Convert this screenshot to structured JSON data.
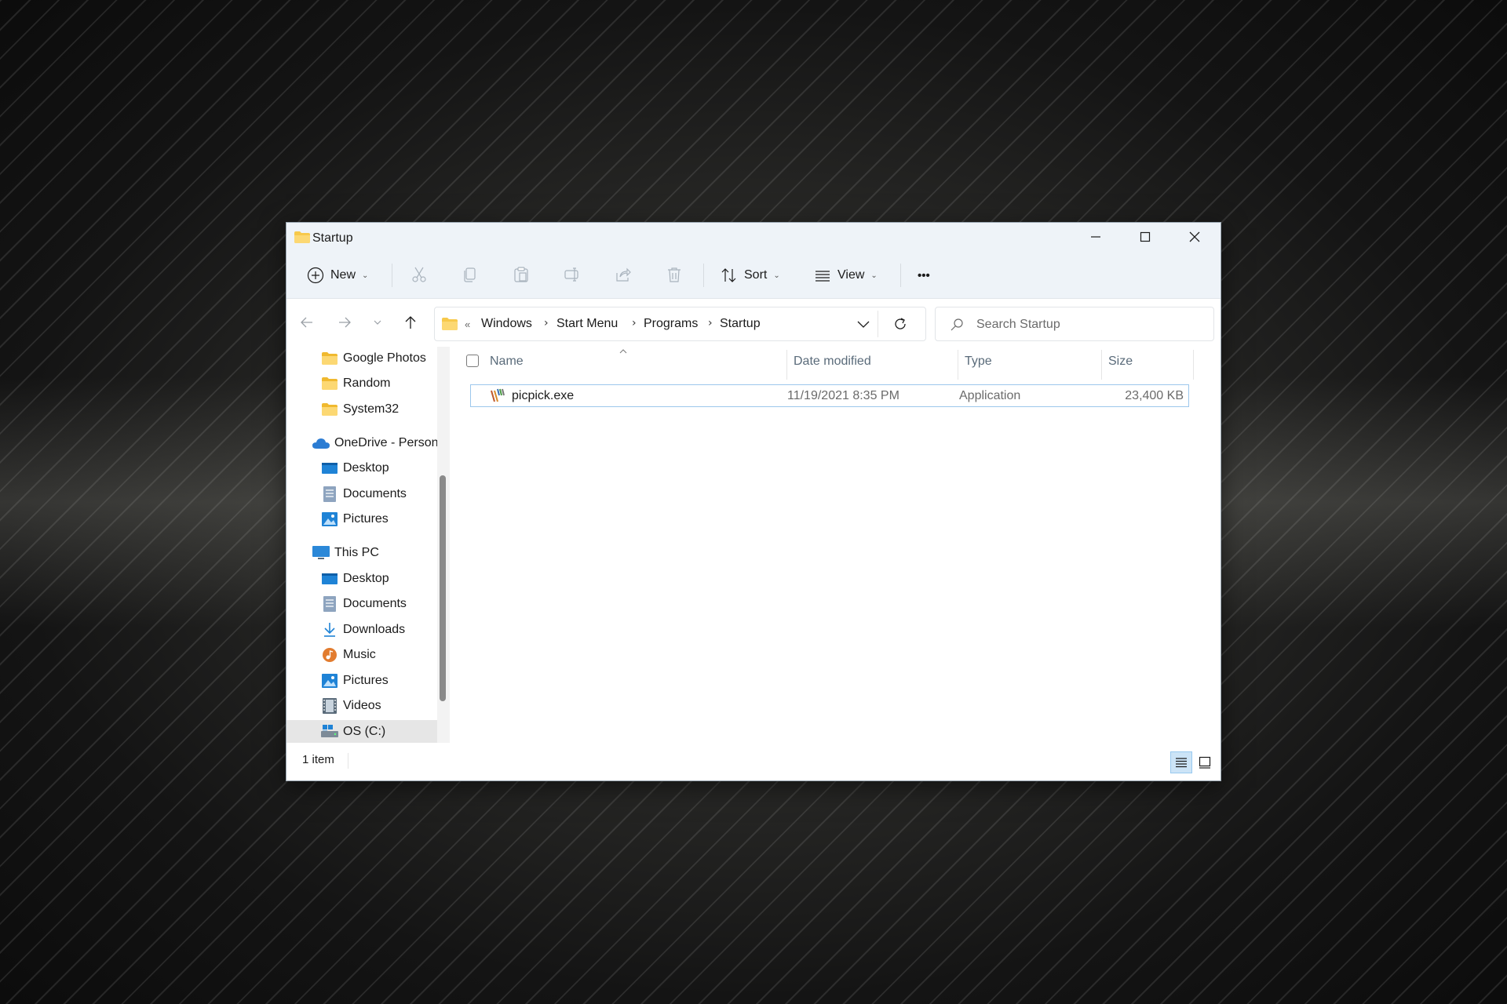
{
  "window": {
    "title": "Startup"
  },
  "commandbar": {
    "new_label": "New",
    "sort_label": "Sort",
    "view_label": "View",
    "more_label": "•••"
  },
  "address": {
    "overflow": "«",
    "segments": [
      "Windows",
      "Start Menu",
      "Programs",
      "Startup"
    ]
  },
  "search": {
    "placeholder": "Search Startup"
  },
  "sidebar": {
    "items": [
      {
        "label": "Google Photos",
        "icon": "folder-icon"
      },
      {
        "label": "Random",
        "icon": "folder-icon"
      },
      {
        "label": "System32",
        "icon": "folder-icon"
      },
      {
        "label": "OneDrive - Personal",
        "icon": "cloud-icon"
      },
      {
        "label": "Desktop",
        "icon": "desktop-icon"
      },
      {
        "label": "Documents",
        "icon": "documents-icon"
      },
      {
        "label": "Pictures",
        "icon": "pictures-icon"
      },
      {
        "label": "This PC",
        "icon": "computer-icon"
      },
      {
        "label": "Desktop",
        "icon": "desktop-icon"
      },
      {
        "label": "Documents",
        "icon": "documents-icon"
      },
      {
        "label": "Downloads",
        "icon": "downloads-icon"
      },
      {
        "label": "Music",
        "icon": "music-icon"
      },
      {
        "label": "Pictures",
        "icon": "pictures-icon"
      },
      {
        "label": "Videos",
        "icon": "videos-icon"
      },
      {
        "label": "OS (C:)",
        "icon": "drive-icon"
      }
    ]
  },
  "columns": {
    "name": "Name",
    "date": "Date modified",
    "type": "Type",
    "size": "Size"
  },
  "files": [
    {
      "name": "picpick.exe",
      "date": "11/19/2021 8:35 PM",
      "type": "Application",
      "size": "23,400 KB"
    }
  ],
  "status": {
    "count": "1 item"
  },
  "colors": {
    "accent": "#0067c0",
    "folder": "#f7c94b",
    "titlebar": "#eef3f8"
  }
}
